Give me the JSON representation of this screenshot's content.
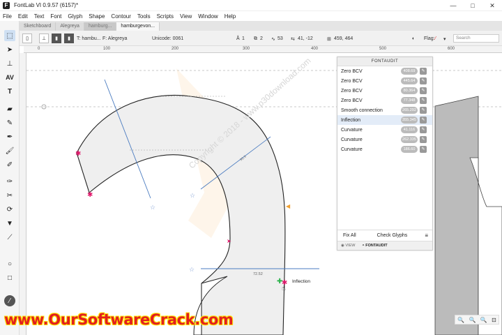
{
  "window": {
    "title": "FontLab VI 0.9.57 (6157)*",
    "logo_letter": "F",
    "minimize": "—",
    "maximize": "□",
    "close": "✕"
  },
  "menu": [
    "File",
    "Edit",
    "Text",
    "Font",
    "Glyph",
    "Shape",
    "Contour",
    "Tools",
    "Scripts",
    "View",
    "Window",
    "Help"
  ],
  "tabs": [
    {
      "label": "Sketchboard",
      "style": "normal"
    },
    {
      "label": "Alegreya",
      "style": "normal"
    },
    {
      "label": "hamburg...",
      "style": "dark"
    },
    {
      "label": "hamburgevon...",
      "style": "active"
    }
  ],
  "toolbar": {
    "text_label": "T: hambu...",
    "font_label": "F: Alegreya",
    "unicode_label": "Unicode: 0061",
    "nodes_count": "1",
    "contours_count": "2",
    "points_count": "53",
    "offset": "41, -12",
    "position": "459, 464",
    "flag_label": "Flag:",
    "search_placeholder": "Search"
  },
  "ruler": {
    "top_ticks": [
      "0",
      "100",
      "200",
      "300",
      "400",
      "500",
      "600"
    ]
  },
  "canvas": {
    "measure_label_1": "95.9",
    "measure_label_2": "72.52",
    "inflection_label": "Inflection",
    "watermark_diag": "Copyright © 2018 - www.p30download.com"
  },
  "fontaudit": {
    "title": "FONTAUDIT",
    "rows": [
      {
        "label": "Zero BCV",
        "value": "408.69"
      },
      {
        "label": "Zero BCV",
        "value": "445.64"
      },
      {
        "label": "Zero BCV",
        "value": "80.364"
      },
      {
        "label": "Zero BCV",
        "value": "77.348"
      },
      {
        "label": "Smooth connection",
        "value": "265.292"
      },
      {
        "label": "Inflection",
        "value": "355.345"
      },
      {
        "label": "Curvature",
        "value": "41.116"
      },
      {
        "label": "Curvature",
        "value": "262.335"
      },
      {
        "label": "Curvature",
        "value": "186.60"
      }
    ],
    "fix_all": "Fix All",
    "check_glyphs": "Check Glyphs",
    "tab_view": "VIEW",
    "tab_fontaudit": "FONTAUDIT"
  },
  "watermark": "www.OurSoftwareCrack.com",
  "colors": {
    "accent": "#3d7cc9",
    "badge": "#bbbbbb",
    "watermark": "#e21f1f",
    "node_pink": "#e0186b",
    "glyph_fill": "#efefef"
  }
}
